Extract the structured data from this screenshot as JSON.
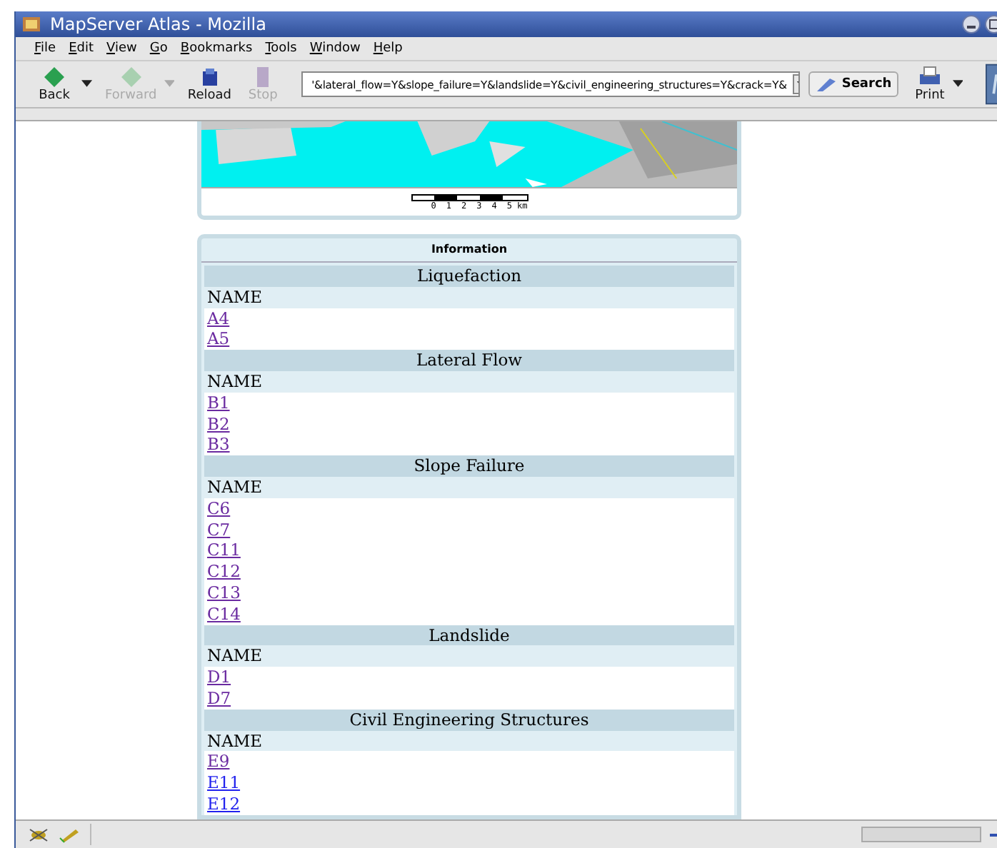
{
  "window": {
    "title": "MapServer Atlas - Mozilla"
  },
  "menu": [
    {
      "label": "File"
    },
    {
      "label": "Edit"
    },
    {
      "label": "View"
    },
    {
      "label": "Go"
    },
    {
      "label": "Bookmarks"
    },
    {
      "label": "Tools"
    },
    {
      "label": "Window"
    },
    {
      "label": "Help"
    }
  ],
  "toolbar": [
    {
      "label": "Back",
      "disabled": false,
      "dropdown": true
    },
    {
      "label": "Forward",
      "disabled": true,
      "dropdown": true
    },
    {
      "label": "Reload",
      "disabled": false,
      "dropdown": false
    },
    {
      "label": "Stop",
      "disabled": true,
      "dropdown": false
    }
  ],
  "address": {
    "value": "'&lateral_flow=Y&slope_failure=Y&landslide=Y&civil_engineering_structures=Y&crack=Y&"
  },
  "search_button": "Search",
  "print_button": "Print",
  "map": {
    "kind": "picture",
    "scale_labels": [
      "0",
      "1",
      "2",
      "3",
      "4",
      "5 km"
    ]
  },
  "information": {
    "title": "Information",
    "sections": [
      {
        "title": "Liquefaction",
        "column": "NAME",
        "links": [
          {
            "text": "A4",
            "visited": true
          },
          {
            "text": "A5",
            "visited": true
          }
        ]
      },
      {
        "title": "Lateral Flow",
        "column": "NAME",
        "links": [
          {
            "text": "B1",
            "visited": true
          },
          {
            "text": "B2",
            "visited": true
          },
          {
            "text": "B3",
            "visited": true
          }
        ]
      },
      {
        "title": "Slope Failure",
        "column": "NAME",
        "links": [
          {
            "text": "C6",
            "visited": true
          },
          {
            "text": "C7",
            "visited": true
          },
          {
            "text": "C11",
            "visited": true
          },
          {
            "text": "C12",
            "visited": true
          },
          {
            "text": "C13",
            "visited": true
          },
          {
            "text": "C14",
            "visited": true
          }
        ]
      },
      {
        "title": "Landslide",
        "column": "NAME",
        "links": [
          {
            "text": "D1",
            "visited": true
          },
          {
            "text": "D7",
            "visited": true
          }
        ]
      },
      {
        "title": "Civil Engineering Structures",
        "column": "NAME",
        "links": [
          {
            "text": "E9",
            "visited": true
          },
          {
            "text": "E11",
            "visited": false
          },
          {
            "text": "E12",
            "visited": false
          }
        ]
      }
    ]
  }
}
